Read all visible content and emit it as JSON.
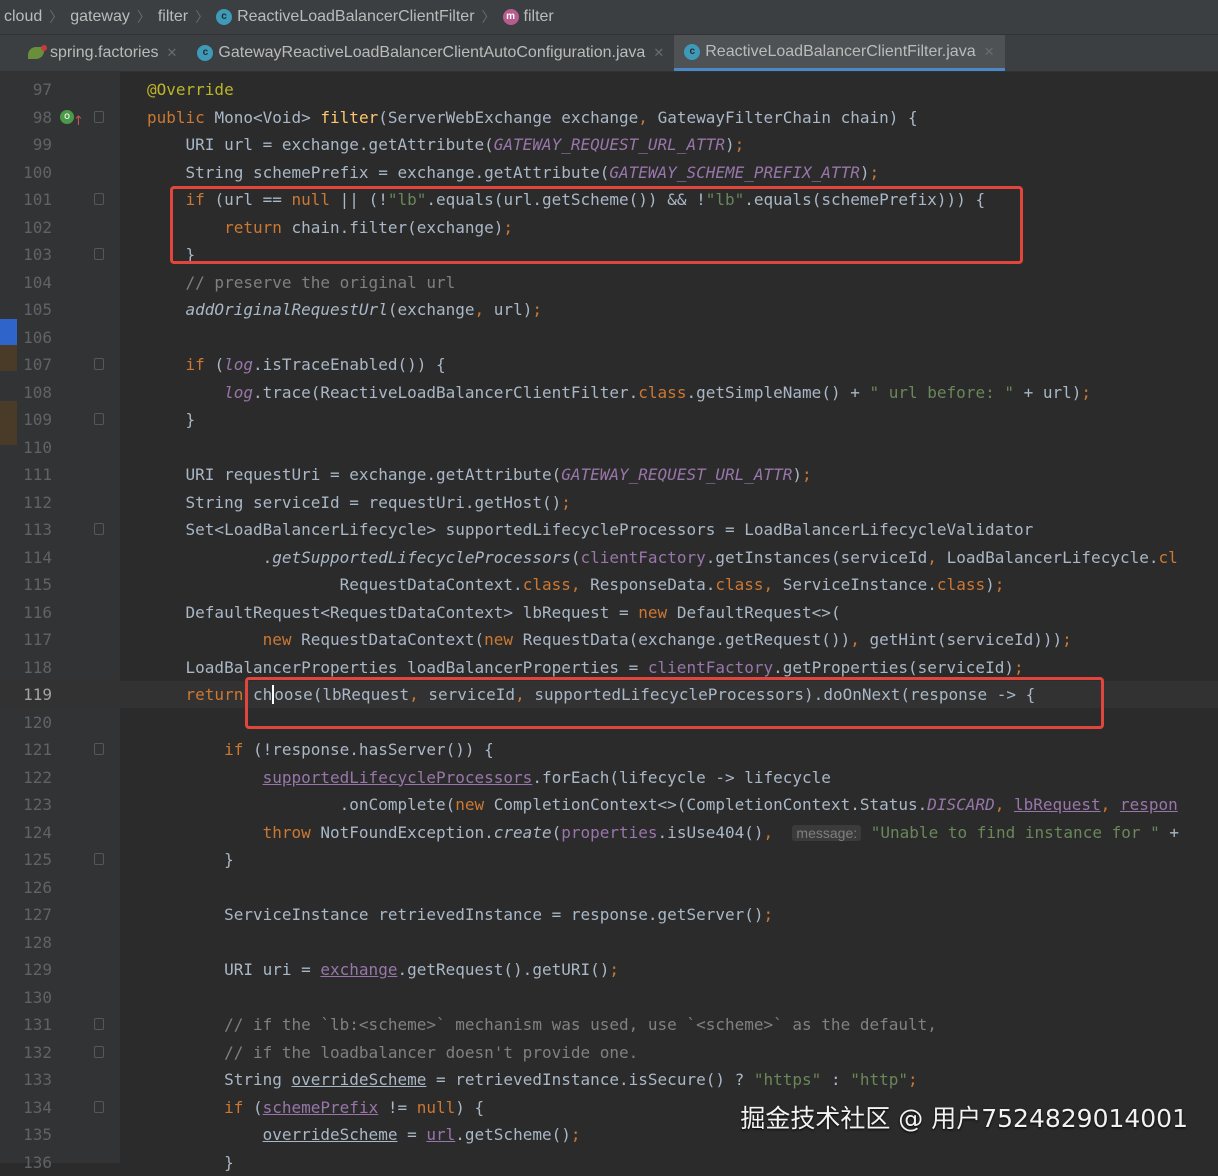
{
  "breadcrumb": {
    "items": [
      "cloud",
      "gateway",
      "filter",
      "ReactiveLoadBalancerClientFilter",
      "filter"
    ],
    "icons": [
      "",
      "",
      "",
      "class-icon",
      "method-icon"
    ]
  },
  "tabs": [
    {
      "label": "spring.factories",
      "icon": "spring-leaf-icon",
      "active": false
    },
    {
      "label": "GatewayReactiveLoadBalancerClientAutoConfiguration.java",
      "icon": "class-icon",
      "active": false
    },
    {
      "label": "ReactiveLoadBalancerClientFilter.java",
      "icon": "class-icon",
      "active": true
    }
  ],
  "colors": {
    "keyword": "#cc7832",
    "string": "#6a8759",
    "constant": "#9876aa",
    "annotation": "#bbb529",
    "method": "#ffc66d",
    "comment": "#808080",
    "text": "#a9b7c6",
    "highlight_box": "#e1463c"
  },
  "code": {
    "current_line": 119,
    "lines": [
      {
        "n": "97",
        "html": "<span style='color:#bbb529'>@Override</span>"
      },
      {
        "n": "98",
        "html": "<span style='color:#cc7832'>public </span>Mono&lt;Void&gt; <span style='color:#ffc66d'>filter</span>(ServerWebExchange exchange<span style='color:#cc7832'>, </span>GatewayFilterChain chain) {"
      },
      {
        "n": "99",
        "html": "    URI url = exchange.getAttribute(<i style='color:#9876aa'>GATEWAY_REQUEST_URL_ATTR</i>)<span style='color:#cc7832'>;</span>"
      },
      {
        "n": "100",
        "html": "    String schemePrefix = exchange.getAttribute(<i style='color:#9876aa'>GATEWAY_SCHEME_PREFIX_ATTR</i>)<span style='color:#cc7832'>;</span>"
      },
      {
        "n": "101",
        "html": "    <span style='color:#cc7832'>if </span>(url == <span style='color:#cc7832'>null </span>|| (!<span style='color:#6a8759'>\"lb\"</span>.equals(url.getScheme()) &amp;&amp; !<span style='color:#6a8759'>\"lb\"</span>.equals(schemePrefix))) {"
      },
      {
        "n": "102",
        "html": "        <span style='color:#cc7832'>return </span>chain.filter(exchange)<span style='color:#cc7832'>;</span>"
      },
      {
        "n": "103",
        "html": "    }"
      },
      {
        "n": "104",
        "html": "    <span style='color:#808080'>// preserve the original url</span>"
      },
      {
        "n": "105",
        "html": "    <i>addOriginalRequestUrl</i>(exchange<span style='color:#cc7832'>, </span>url)<span style='color:#cc7832'>;</span>"
      },
      {
        "n": "106",
        "html": ""
      },
      {
        "n": "107",
        "html": "    <span style='color:#cc7832'>if </span>(<i style='color:#9876aa'>log</i>.isTraceEnabled()) {"
      },
      {
        "n": "108",
        "html": "        <i style='color:#9876aa'>log</i>.trace(ReactiveLoadBalancerClientFilter.<span style='color:#cc7832'>class</span>.getSimpleName() + <span style='color:#6a8759'>\" url before: \"</span> + url)<span style='color:#cc7832'>;</span>"
      },
      {
        "n": "109",
        "html": "    }"
      },
      {
        "n": "110",
        "html": ""
      },
      {
        "n": "111",
        "html": "    URI requestUri = exchange.getAttribute(<i style='color:#9876aa'>GATEWAY_REQUEST_URL_ATTR</i>)<span style='color:#cc7832'>;</span>"
      },
      {
        "n": "112",
        "html": "    String serviceId = requestUri.getHost()<span style='color:#cc7832'>;</span>"
      },
      {
        "n": "113",
        "html": "    Set&lt;LoadBalancerLifecycle&gt; supportedLifecycleProcessors = LoadBalancerLifecycleValidator"
      },
      {
        "n": "114",
        "html": "            .<i>getSupportedLifecycleProcessors</i>(<span style='color:#9876aa'>clientFactory</span>.getInstances(serviceId<span style='color:#cc7832'>, </span>LoadBalancerLifecycle.<span style='color:#cc7832'>cl</span>"
      },
      {
        "n": "115",
        "html": "                    RequestDataContext.<span style='color:#cc7832'>class, </span>ResponseData.<span style='color:#cc7832'>class, </span>ServiceInstance.<span style='color:#cc7832'>class</span>)<span style='color:#cc7832'>;</span>"
      },
      {
        "n": "116",
        "html": "    DefaultRequest&lt;RequestDataContext&gt; lbRequest = <span style='color:#cc7832'>new </span>DefaultRequest&lt;&gt;("
      },
      {
        "n": "117",
        "html": "            <span style='color:#cc7832'>new </span>RequestDataContext(<span style='color:#cc7832'>new </span>RequestData(exchange.getRequest())<span style='color:#cc7832'>, </span>getHint(serviceId)))<span style='color:#cc7832'>;</span>"
      },
      {
        "n": "118",
        "html": "    LoadBalancerProperties loadBalancerProperties = <span style='color:#9876aa'>clientFactory</span>.getProperties(serviceId)<span style='color:#cc7832'>;</span>"
      },
      {
        "n": "119",
        "html": "    <span style='color:#cc7832'>return </span>ch<span class='cursor'></span>oose(lbRequest<span style='color:#cc7832'>, </span>serviceId<span style='color:#cc7832'>, </span>supportedLifecycleProcessors).doOnNext(response -&gt; {"
      },
      {
        "n": "120",
        "html": ""
      },
      {
        "n": "121",
        "html": "        <span style='color:#cc7832'>if </span>(!response.hasServer()) {"
      },
      {
        "n": "122",
        "html": "            <u style='color:#9876aa'>supportedLifecycleProcessors</u>.forEach(lifecycle -&gt; lifecycle"
      },
      {
        "n": "123",
        "html": "                    .onComplete(<span style='color:#cc7832'>new </span>CompletionContext&lt;&gt;(CompletionContext.Status.<i style='color:#9876aa'>DISCARD</i><span style='color:#cc7832'>, </span><u style='color:#9876aa'>lbRequest</u><span style='color:#cc7832'>, </span><u style='color:#9876aa'>respon</u>"
      },
      {
        "n": "124",
        "html": "            <span style='color:#cc7832'>throw </span>NotFoundException.<i>create</i>(<span style='color:#9876aa'>properties</span>.isUse404()<span style='color:#cc7832'>, </span> <span class='hint'>message:</span> <span style='color:#6a8759'>\"Unable to find instance for \"</span> +"
      },
      {
        "n": "125",
        "html": "        }"
      },
      {
        "n": "126",
        "html": ""
      },
      {
        "n": "127",
        "html": "        ServiceInstance retrievedInstance = response.getServer()<span style='color:#cc7832'>;</span>"
      },
      {
        "n": "128",
        "html": ""
      },
      {
        "n": "129",
        "html": "        URI uri = <u style='color:#9876aa'>exchange</u>.getRequest().getURI()<span style='color:#cc7832'>;</span>"
      },
      {
        "n": "130",
        "html": ""
      },
      {
        "n": "131",
        "html": "        <span style='color:#808080'>// if the `lb:&lt;scheme&gt;` mechanism was used, use `&lt;scheme&gt;` as the default,</span>"
      },
      {
        "n": "132",
        "html": "        <span style='color:#808080'>// if the loadbalancer doesn't provide one.</span>"
      },
      {
        "n": "133",
        "html": "        String <u>overrideScheme</u> = retrievedInstance.isSecure() ? <span style='color:#6a8759'>\"https\"</span> : <span style='color:#6a8759'>\"http\"</span><span style='color:#cc7832'>;</span>"
      },
      {
        "n": "134",
        "html": "        <span style='color:#cc7832'>if </span>(<u style='color:#9876aa'>schemePrefix</u> != <span style='color:#cc7832'>null</span>) {"
      },
      {
        "n": "135",
        "html": "            <u>overrideScheme</u> = <u style='color:#9876aa'>url</u>.getScheme()<span style='color:#cc7832'>;</span>"
      },
      {
        "n": "136",
        "html": "        }"
      }
    ]
  },
  "watermark": "掘金技术社区 @ 用户7524829014001"
}
